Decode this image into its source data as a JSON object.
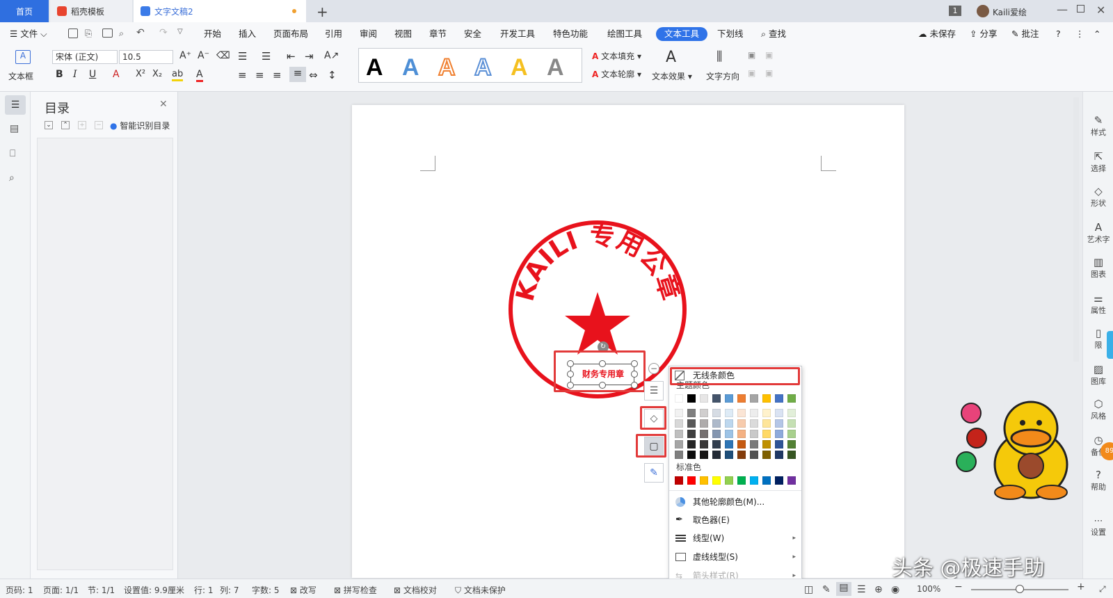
{
  "tabs": {
    "home": "首页",
    "template": "稻壳模板",
    "document": "文字文稿2"
  },
  "titlebar": {
    "badge": "1",
    "user": "Kaili爱绘"
  },
  "menu": {
    "file": "文件",
    "items": [
      "开始",
      "插入",
      "页面布局",
      "引用",
      "审阅",
      "视图",
      "章节",
      "安全",
      "开发工具",
      "特色功能",
      "绘图工具",
      "文本工具",
      "下划线"
    ],
    "active": "文本工具",
    "search": "查找",
    "unsaved": "未保存",
    "share": "分享",
    "comment": "批注",
    "help": "?"
  },
  "ribbon": {
    "textbox": "文本框",
    "font": "宋体 (正文)",
    "size": "10.5",
    "art_glyph": "A",
    "text_fill": "文本填充",
    "text_outline": "文本轮廓",
    "text_effect": "文本效果",
    "text_direction": "文字方向"
  },
  "toc": {
    "title": "目录",
    "smart": "智能识别目录"
  },
  "stamp": {
    "ring_text": "KAILI 专用公章",
    "box_text": "财务专用章"
  },
  "dropdown": {
    "no_line": "无线条颜色",
    "theme_label": "主题颜色",
    "standard_label": "标准色",
    "more": "其他轮廓颜色(M)...",
    "picker": "取色器(E)",
    "line_type": "线型(W)",
    "dash_type": "虚线线型(S)",
    "arrow": "箭头样式(R)",
    "theme_top": [
      "#ffffff",
      "#000000",
      "#e7e6e6",
      "#44546a",
      "#5b9bd5",
      "#ed7d31",
      "#a5a5a5",
      "#ffc000",
      "#4472c4",
      "#70ad47"
    ],
    "theme_shades": [
      [
        "#f2f2f2",
        "#7f7f7f",
        "#d0cece",
        "#d6dce4",
        "#deebf6",
        "#fbe5d5",
        "#ededed",
        "#fff2cc",
        "#dae3f3",
        "#e2efd9"
      ],
      [
        "#d8d8d8",
        "#595959",
        "#aeabab",
        "#adb9ca",
        "#bdd7ee",
        "#f7cbac",
        "#dbdbdb",
        "#fee599",
        "#b4c6e7",
        "#c5e0b3"
      ],
      [
        "#bfbfbf",
        "#3f3f3f",
        "#757070",
        "#8496b0",
        "#9dc3e6",
        "#f4b183",
        "#c9c9c9",
        "#ffd965",
        "#8eaadb",
        "#a8d08d"
      ],
      [
        "#a5a5a5",
        "#262626",
        "#3a3838",
        "#323f4f",
        "#2e75b5",
        "#c55a11",
        "#7b7b7b",
        "#bf9000",
        "#2f5496",
        "#538135"
      ],
      [
        "#7f7f7f",
        "#0c0c0c",
        "#171616",
        "#222a35",
        "#1e4e79",
        "#833c0b",
        "#525252",
        "#7f6000",
        "#1f3864",
        "#375623"
      ]
    ],
    "standard": [
      "#c00000",
      "#ff0000",
      "#ffc000",
      "#ffff00",
      "#92d050",
      "#00b050",
      "#00b0f0",
      "#0070c0",
      "#002060",
      "#7030a0"
    ]
  },
  "rightrail": [
    "样式",
    "选择",
    "形状",
    "艺术字",
    "图表",
    "属性",
    "限",
    "图库",
    "风格",
    "备份",
    "帮助",
    "设置"
  ],
  "status": {
    "page_code": "页码: 1",
    "pages": "页面: 1/1",
    "section": "节: 1/1",
    "setting": "设置值: 9.9厘米",
    "row": "行: 1",
    "col": "列: 7",
    "words": "字数: 5",
    "revise": "改写",
    "spell": "拼写检查",
    "proof": "文档校对",
    "protect": "文档未保护",
    "zoom": "100%"
  },
  "watermark": "头条 @极速手助",
  "mascot_badge": "89",
  "colors": {
    "accent": "#2f73e8",
    "stamp": "#e8121c",
    "highlight": "#e23a3a"
  }
}
